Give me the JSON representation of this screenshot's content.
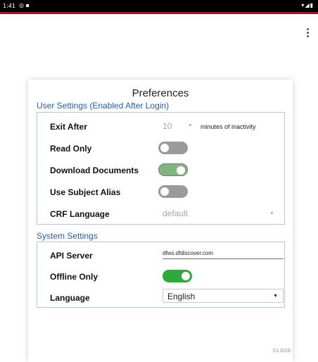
{
  "status_bar": {
    "time": "1:41",
    "left_icons": "◎ ▪",
    "right_icons": "▾◢▮"
  },
  "menu": {
    "icon": "more-vert-icon"
  },
  "dialog": {
    "title": "Preferences",
    "user_settings": {
      "title": "User Settings (Enabled After Login)",
      "exit_after": {
        "label": "Exit After",
        "value": "10",
        "suffix": "minutes of inactivity"
      },
      "read_only": {
        "label": "Read Only",
        "on": false
      },
      "download_documents": {
        "label": "Download Documents",
        "on": true
      },
      "use_subject_alias": {
        "label": "Use Subject Alias",
        "on": false
      },
      "crf_language": {
        "label": "CRF Language",
        "value": "default"
      }
    },
    "system_settings": {
      "title": "System Settings",
      "api_server": {
        "label": "API Server",
        "value": "dfws.dfdiscover.com"
      },
      "offline_only": {
        "label": "Offline Only",
        "on": true
      },
      "language": {
        "label": "Language",
        "value": "English"
      }
    },
    "close_label": "CLOSE"
  },
  "colors": {
    "accent_red": "#d0021b",
    "section_blue": "#2a5aa8",
    "toggle_on": "#2eaa3a",
    "toggle_off": "#9a9a9a"
  }
}
